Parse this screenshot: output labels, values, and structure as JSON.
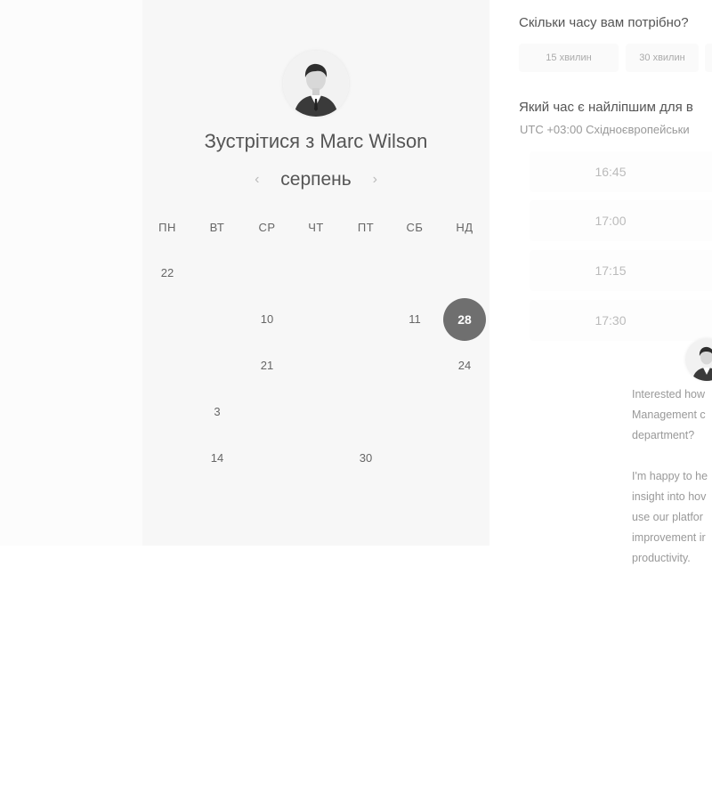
{
  "calendar": {
    "title_prefix": "Зустрітися з",
    "host_name": "Marc Wilson",
    "month": "серпень",
    "prev_icon": "chevron-left-icon",
    "next_icon": "chevron-right-icon",
    "weekdays": [
      "ПН",
      "ВТ",
      "СР",
      "ЧТ",
      "ПТ",
      "СБ",
      "НД"
    ],
    "weeks": [
      [
        {
          "label": "22",
          "state": "available"
        },
        {
          "label": "",
          "state": "disabled"
        },
        {
          "label": "",
          "state": "disabled"
        },
        {
          "label": "",
          "state": "disabled"
        },
        {
          "label": "",
          "state": "disabled"
        },
        {
          "label": "",
          "state": "disabled"
        },
        {
          "label": "",
          "state": "disabled"
        }
      ],
      [
        {
          "label": "",
          "state": "disabled"
        },
        {
          "label": "",
          "state": "disabled"
        },
        {
          "label": "10",
          "state": "available"
        },
        {
          "label": "",
          "state": "disabled"
        },
        {
          "label": "",
          "state": "disabled"
        },
        {
          "label": "11",
          "state": "available"
        },
        {
          "label": "28",
          "state": "selected"
        }
      ],
      [
        {
          "label": "",
          "state": "disabled"
        },
        {
          "label": "",
          "state": "disabled"
        },
        {
          "label": "21",
          "state": "available"
        },
        {
          "label": "",
          "state": "disabled"
        },
        {
          "label": "",
          "state": "disabled"
        },
        {
          "label": "",
          "state": "disabled"
        },
        {
          "label": "24",
          "state": "available"
        }
      ],
      [
        {
          "label": "",
          "state": "disabled"
        },
        {
          "label": "3",
          "state": "available"
        },
        {
          "label": "",
          "state": "disabled"
        },
        {
          "label": "",
          "state": "disabled"
        },
        {
          "label": "",
          "state": "disabled"
        },
        {
          "label": "",
          "state": "disabled"
        },
        {
          "label": "",
          "state": "disabled"
        }
      ],
      [
        {
          "label": "",
          "state": "disabled"
        },
        {
          "label": "14",
          "state": "available"
        },
        {
          "label": "",
          "state": "disabled"
        },
        {
          "label": "",
          "state": "disabled"
        },
        {
          "label": "30",
          "state": "available"
        },
        {
          "label": "",
          "state": "disabled"
        },
        {
          "label": "",
          "state": "disabled"
        }
      ]
    ]
  },
  "duration": {
    "question": "Скільки часу вам потрібно?",
    "options": [
      "15 хвилин",
      "30 хвилин"
    ]
  },
  "time": {
    "question": "Який час є найліпшим для в",
    "timezone": "UTC +03:00 Східноєвропейськи",
    "slots": [
      "16:45",
      "17:00",
      "17:15",
      "17:30"
    ]
  },
  "chat": {
    "paragraphs": [
      [
        "Interested how",
        "Management c",
        "department?"
      ],
      [
        "I'm happy to he",
        "insight into hov",
        "use our platfor",
        "improvement ir",
        "productivity."
      ]
    ]
  },
  "colors": {
    "panel_bg": "#f7f7f7",
    "selected_day": "#6f6f6f",
    "text_muted": "#999999"
  }
}
